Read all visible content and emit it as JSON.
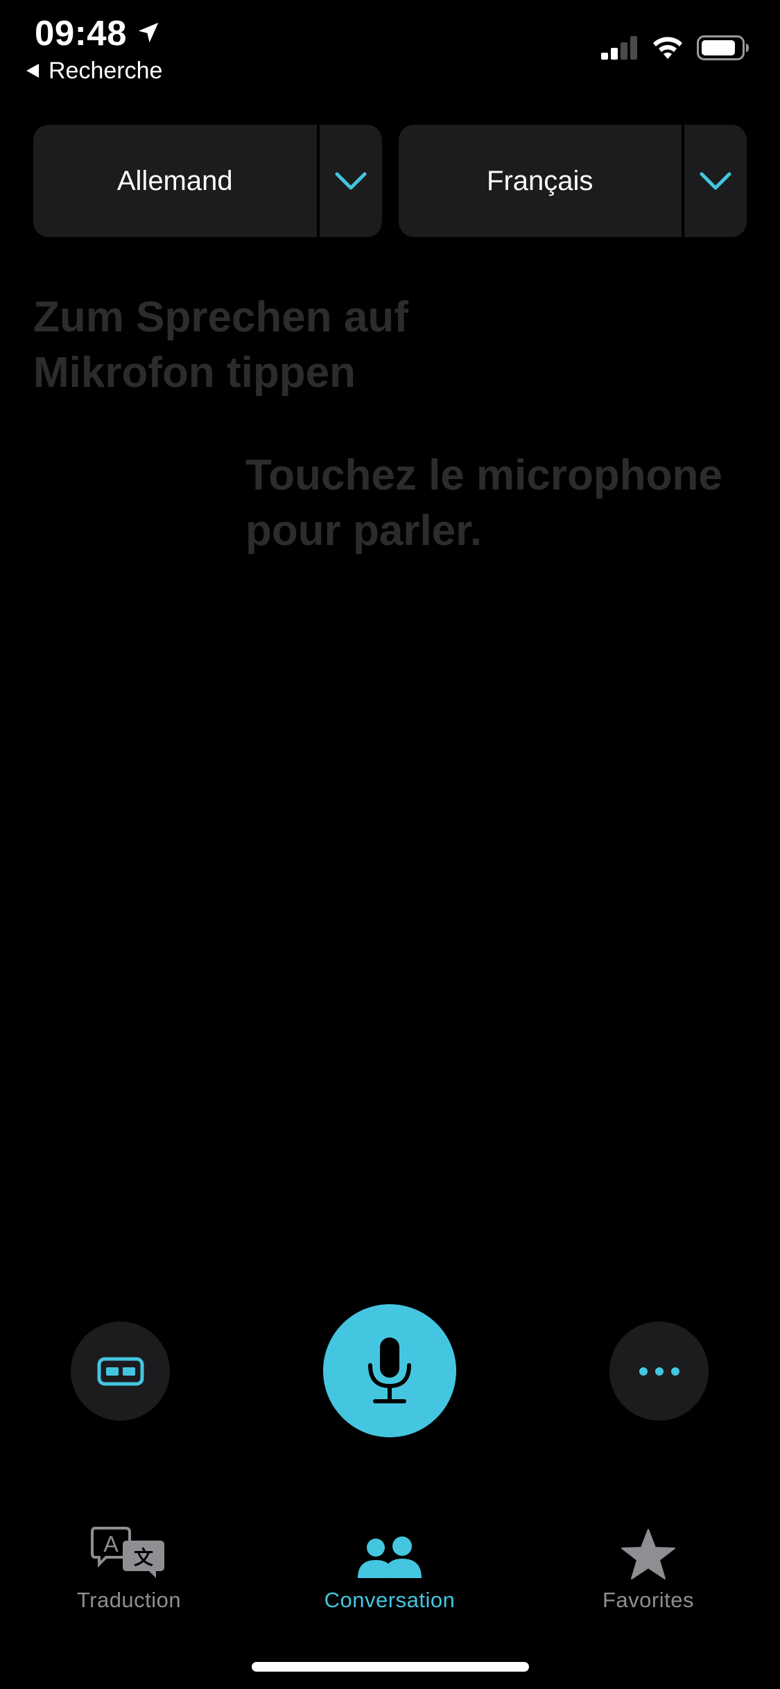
{
  "status_bar": {
    "time": "09:48",
    "back_label": "Recherche",
    "signal_icon": "cellular-signal-icon",
    "wifi_icon": "wifi-icon",
    "battery_icon": "battery-icon",
    "location_icon": "location-arrow-icon"
  },
  "languages": {
    "source": "Allemand",
    "target": "Français"
  },
  "prompts": {
    "source": "Zum Sprechen auf Mikrofon tippen",
    "target": "Touchez le microphone pour parler."
  },
  "controls": {
    "left_icon": "side-by-side-view-icon",
    "center_icon": "microphone-icon",
    "right_icon": "ellipsis-icon"
  },
  "tabs": [
    {
      "label": "Traduction",
      "icon": "translate-icon",
      "active": false
    },
    {
      "label": "Conversation",
      "icon": "people-icon",
      "active": true
    },
    {
      "label": "Favorites",
      "icon": "star-icon",
      "active": false
    }
  ],
  "colors": {
    "accent": "#45c6e0",
    "background": "#000000",
    "pill": "#1c1c1e",
    "prompt_text": "#2c2c2e",
    "inactive_tab": "#8e8e93"
  }
}
